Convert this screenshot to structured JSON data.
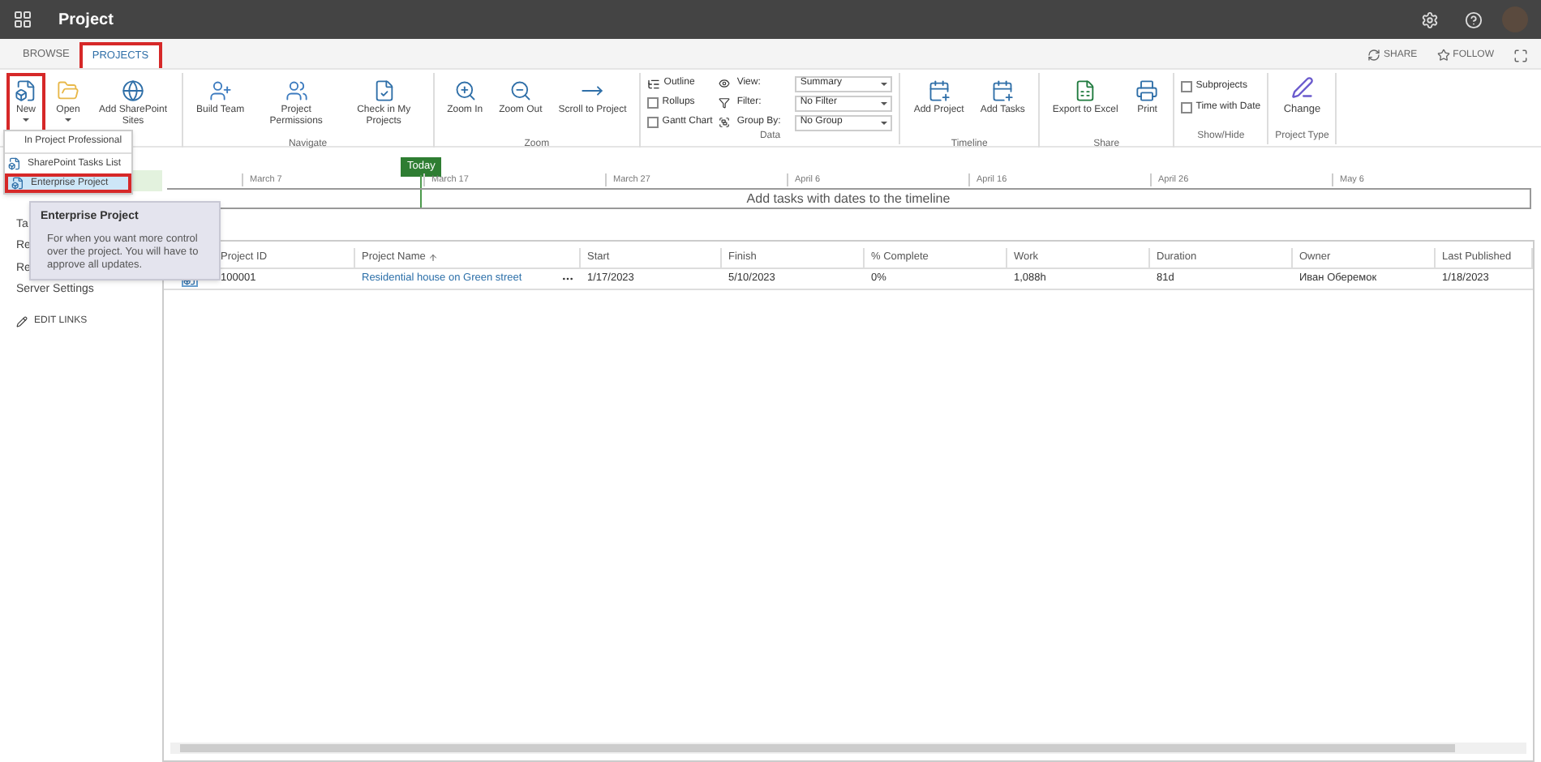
{
  "app_title": "Project",
  "ribbon_tabs": [
    {
      "label": "BROWSE",
      "selected": false
    },
    {
      "label": "PROJECTS",
      "selected": true
    }
  ],
  "page_actions": [
    "SHARE",
    "FOLLOW"
  ],
  "ribbon_groups": [
    {
      "buttons": [
        {
          "label": "New",
          "menu": true,
          "selected": true
        },
        {
          "label": "Open",
          "menu": true,
          "selected": false
        },
        {
          "label": "Add SharePoint Sites",
          "selected": false
        }
      ]
    },
    {
      "label": "Navigate",
      "buttons": [
        {
          "label": "Build Team",
          "selected": false
        },
        {
          "label": "Project Permissions",
          "selected": false
        },
        {
          "label": "Check in My Projects",
          "selected": false
        }
      ]
    },
    {
      "label": "Zoom",
      "buttons": [
        {
          "label": "Zoom In",
          "selected": false
        },
        {
          "label": "Zoom Out",
          "selected": false
        },
        {
          "label": "Scroll to Project",
          "selected": false
        }
      ]
    }
  ],
  "data_group": {
    "label": "Data",
    "checks": [
      {
        "label": "Outline",
        "kind": "menu"
      },
      {
        "label": "Rollups",
        "kind": "check",
        "checked": false
      },
      {
        "label": "Gantt Chart",
        "kind": "check",
        "checked": false
      }
    ],
    "fields": [
      {
        "label": "View:",
        "value": "Summary"
      },
      {
        "label": "Filter:",
        "value": "No Filter"
      },
      {
        "label": "Group By:",
        "value": "No Group"
      }
    ]
  },
  "ribbon_groups_2": [
    {
      "label": "Timeline",
      "buttons": [
        {
          "label": "Add Project"
        },
        {
          "label": "Add Tasks"
        }
      ]
    },
    {
      "label": "Share",
      "buttons": [
        {
          "label": "Export to Excel"
        },
        {
          "label": "Print"
        }
      ]
    }
  ],
  "show_hide": {
    "label": "Show/Hide",
    "options": [
      {
        "label": "Subprojects",
        "checked": false
      },
      {
        "label": "Time with Date",
        "checked": false
      }
    ]
  },
  "project_type": {
    "label": "Project Type",
    "button": "Change"
  },
  "new_menu": {
    "header": "In Project Professional",
    "items": [
      {
        "label": "SharePoint Tasks List",
        "selected": false
      },
      {
        "label": "Enterprise Project",
        "selected": true
      }
    ]
  },
  "tooltip": {
    "title": "Enterprise Project",
    "text": "For when you want more control over the project. You will have to approve all updates."
  },
  "sidebar": {
    "items": [
      "Ta",
      "Re",
      "Re",
      "Server Settings"
    ],
    "edit_links": "EDIT LINKS"
  },
  "timeline": {
    "today": "Today",
    "dates": [
      "March 7",
      "March 17",
      "March 27",
      "April 6",
      "April 16",
      "April 26",
      "May 6"
    ],
    "placeholder": "Add tasks with dates to the timeline"
  },
  "table": {
    "columns": [
      "Project ID",
      "Project Name",
      "Start",
      "Finish",
      "% Complete",
      "Work",
      "Duration",
      "Owner",
      "Last Published"
    ],
    "rows": [
      {
        "cells": [
          "100001",
          "Residential house on Green street",
          "1/17/2023",
          "5/10/2023",
          "0%",
          "1,088h",
          "81d",
          "Иван Оберемок",
          "1/18/2023"
        ],
        "selected": false
      }
    ]
  }
}
